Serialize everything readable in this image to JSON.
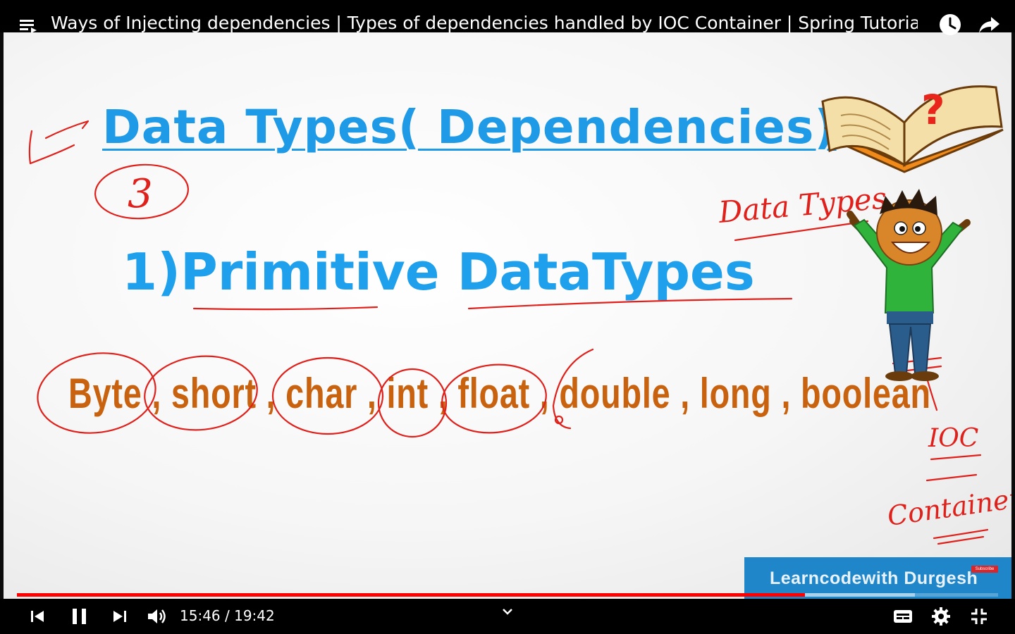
{
  "header": {
    "title": "Ways of Injecting dependencies | Types of dependencies handled by IOC Container | Spring Tutorial",
    "icons": [
      "playlist-icon",
      "watch-later-icon",
      "share-icon"
    ]
  },
  "slide": {
    "title": "Data Types( Dependencies)",
    "heading": "1)Primitive DataTypes",
    "types_line": "Byte , short , char , int , float , double , long , boolean",
    "annotations": {
      "circled_number": "3",
      "side_note": "Data Types",
      "ioc_note": "IOC",
      "container_note": "Container"
    },
    "brand": "Learncodewith Durgesh",
    "subscribe_badge": "Subscribe"
  },
  "player": {
    "current_time": "15:46",
    "duration": "19:42",
    "time_text": "15:46 / 19:42",
    "progress_fraction": 0.803,
    "buffered_fraction": 0.915,
    "colors": {
      "played": "#ff0000",
      "title_blue": "#1e9ae6",
      "types_orange": "#c8620f",
      "ink_red": "#e0201b",
      "brand_blue": "#1f86c9"
    },
    "controls": [
      "previous-icon",
      "pause-icon",
      "next-icon",
      "volume-icon",
      "chevron-down-icon",
      "captions-icon",
      "settings-gear-icon",
      "exit-fullscreen-icon"
    ]
  }
}
